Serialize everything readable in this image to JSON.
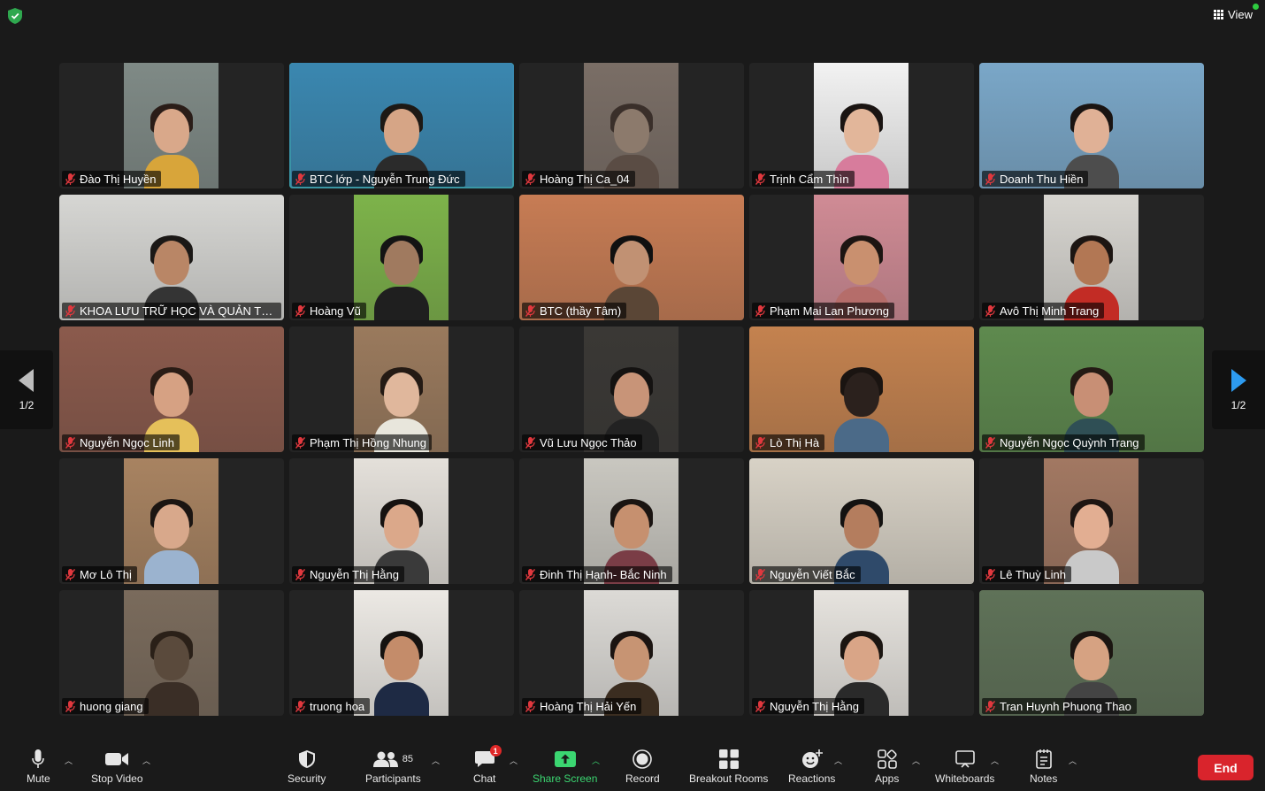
{
  "header": {
    "view_label": "View"
  },
  "pager": {
    "left_label": "1/2",
    "right_label": "1/2"
  },
  "participants": [
    {
      "name": "Đào Thị Huyền",
      "bg": "#7f8a86",
      "skin": "#d9a88a",
      "hair": "#2a1d18",
      "shirt": "#d8a53a"
    },
    {
      "name": "BTC lớp - Nguyễn Trung Đức",
      "bg": "#3a87b0",
      "skin": "#d6a586",
      "hair": "#1d1915",
      "shirt": "#2b2b2b",
      "full": true,
      "active": true
    },
    {
      "name": "Hoàng Thị Ca_04",
      "bg": "#7a6e66",
      "skin": "#8c7a6c",
      "hair": "#3a2f2a",
      "shirt": "#5a4c44"
    },
    {
      "name": "Trịnh Cẩm Thìn",
      "bg": "#f2f2f2",
      "skin": "#e2b69a",
      "hair": "#1a1412",
      "shirt": "#d77c9c"
    },
    {
      "name": "Doanh Thu Hiền",
      "bg": "#7aa7c8",
      "skin": "#e0b196",
      "hair": "#1a1412",
      "shirt": "#4d4d4d",
      "full": true
    },
    {
      "name": "KHOA LƯU TRỮ HỌC VÀ QUẢN TRỊ VĂ...",
      "bg": "#d6d6d3",
      "skin": "#b98666",
      "hair": "#1b1816",
      "shirt": "#343434",
      "full": true
    },
    {
      "name": "Hoàng Vũ",
      "bg": "#7db34a",
      "skin": "#a07a5f",
      "hair": "#141414",
      "shirt": "#1f1f1f"
    },
    {
      "name": "BTC (thầy Tâm)",
      "bg": "#c77c54",
      "skin": "#c19173",
      "hair": "#101010",
      "shirt": "#5a4636",
      "full": true
    },
    {
      "name": "Phạm Mai Lan Phương",
      "bg": "#d08b95",
      "skin": "#c9906f",
      "hair": "#1c1512",
      "shirt": "#b56d6a"
    },
    {
      "name": "Avô Thị Minh Trang",
      "bg": "#d7d5d0",
      "skin": "#b27754",
      "hair": "#1c1512",
      "shirt": "#c22c25"
    },
    {
      "name": "Nguyễn Ngọc Linh",
      "bg": "#8b5a4c",
      "skin": "#d6a183",
      "hair": "#2a1c15",
      "shirt": "#e5c05a",
      "full": true
    },
    {
      "name": "Phạm Thị Hồng Nhung",
      "bg": "#9a7a5d",
      "skin": "#e0b79c",
      "hair": "#241a14",
      "shirt": "#e8e6dc"
    },
    {
      "name": "Vũ Lưu Ngọc Thảo",
      "bg": "#3a3835",
      "skin": "#c89478",
      "hair": "#141211",
      "shirt": "#222"
    },
    {
      "name": "Lò Thị Hà",
      "bg": "#c4824f",
      "skin": "#2b211d",
      "hair": "#1a1411",
      "shirt": "#4b6a88",
      "full": true
    },
    {
      "name": "Nguyễn Ngọc Quỳnh Trang",
      "bg": "#5e8a4e",
      "skin": "#c88f75",
      "hair": "#241a14",
      "shirt": "#2f4f55",
      "full": true
    },
    {
      "name": "Mơ Lô Thị",
      "bg": "#a88361",
      "skin": "#d8a88b",
      "hair": "#1b1512",
      "shirt": "#9bb3cf"
    },
    {
      "name": "Nguyễn Thị Hằng",
      "bg": "#e4e0da",
      "skin": "#dba88a",
      "hair": "#161210",
      "shirt": "#3a3a3a"
    },
    {
      "name": "Đinh Thị Hạnh- Bắc Ninh",
      "bg": "#c9c7c0",
      "skin": "#c6906f",
      "hair": "#1a1411",
      "shirt": "#7a3d46"
    },
    {
      "name": "Nguyễn Viết Bắc",
      "bg": "#d8d2c6",
      "skin": "#b47d5e",
      "hair": "#141211",
      "shirt": "#2f4a6a",
      "full": true
    },
    {
      "name": "Lê Thuỳ Linh",
      "bg": "#a27862",
      "skin": "#e2ae92",
      "hair": "#1d1512",
      "shirt": "#c9c9c9"
    },
    {
      "name": "huong giang",
      "bg": "#7a6b5c",
      "skin": "#5a4a3c",
      "hair": "#2a2018",
      "shirt": "#3a2e26"
    },
    {
      "name": "truong hoa",
      "bg": "#ece9e4",
      "skin": "#c48c6a",
      "hair": "#151210",
      "shirt": "#1e2a44"
    },
    {
      "name": "Hoàng Thị Hải Yến",
      "bg": "#dcdad6",
      "skin": "#c79473",
      "hair": "#1b1411",
      "shirt": "#3b2d20"
    },
    {
      "name": "Nguyễn Thị Hằng",
      "bg": "#e6e3de",
      "skin": "#d9a587",
      "hair": "#1b1511",
      "shirt": "#2a2a2a"
    },
    {
      "name": "Tran Huynh Phuong Thao",
      "bg": "#5f7258",
      "skin": "#d6a282",
      "hair": "#1b1511",
      "shirt": "#444",
      "full": true
    }
  ],
  "toolbar": {
    "mute": "Mute",
    "stop_video": "Stop Video",
    "security": "Security",
    "participants": "Participants",
    "participants_count": "85",
    "chat": "Chat",
    "chat_badge": "1",
    "share_screen": "Share Screen",
    "record": "Record",
    "breakout_rooms": "Breakout Rooms",
    "reactions": "Reactions",
    "apps": "Apps",
    "whiteboards": "Whiteboards",
    "notes": "Notes",
    "end": "End"
  },
  "colors": {
    "accent_green": "#3bd671",
    "end_red": "#d9242c",
    "mic_off_red": "#e0383e"
  }
}
